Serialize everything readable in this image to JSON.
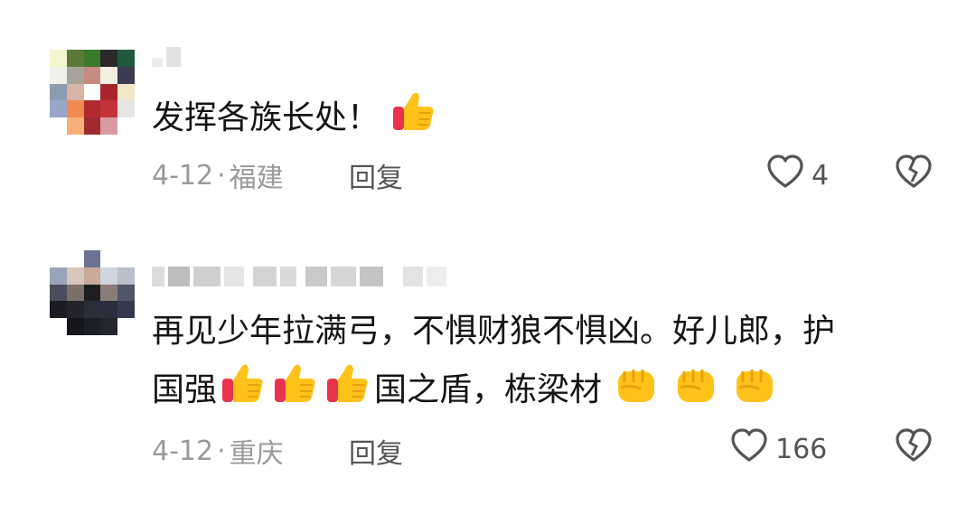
{
  "comments": [
    {
      "text_segments": [
        "发挥各族长处！"
      ],
      "emojis": [
        "thumbs-up"
      ],
      "date": "4-12",
      "location": "福建",
      "reply_label": "回复",
      "likes": "4"
    },
    {
      "text_line1": "再见少年拉满弓，不惧财狼不惧凶。好儿郎，护",
      "text_line2_a": "国强",
      "text_line2_b": "国之盾，栋梁材",
      "emojis_a": [
        "thumbs-up",
        "thumbs-up",
        "thumbs-up"
      ],
      "emojis_b": [
        "raised-fist",
        "raised-fist",
        "raised-fist"
      ],
      "date": "4-12",
      "location": "重庆",
      "reply_label": "回复",
      "likes": "166"
    }
  ],
  "separator": "·",
  "colors": {
    "text": "#151515",
    "meta": "#9a9a9a",
    "action": "#555555"
  }
}
